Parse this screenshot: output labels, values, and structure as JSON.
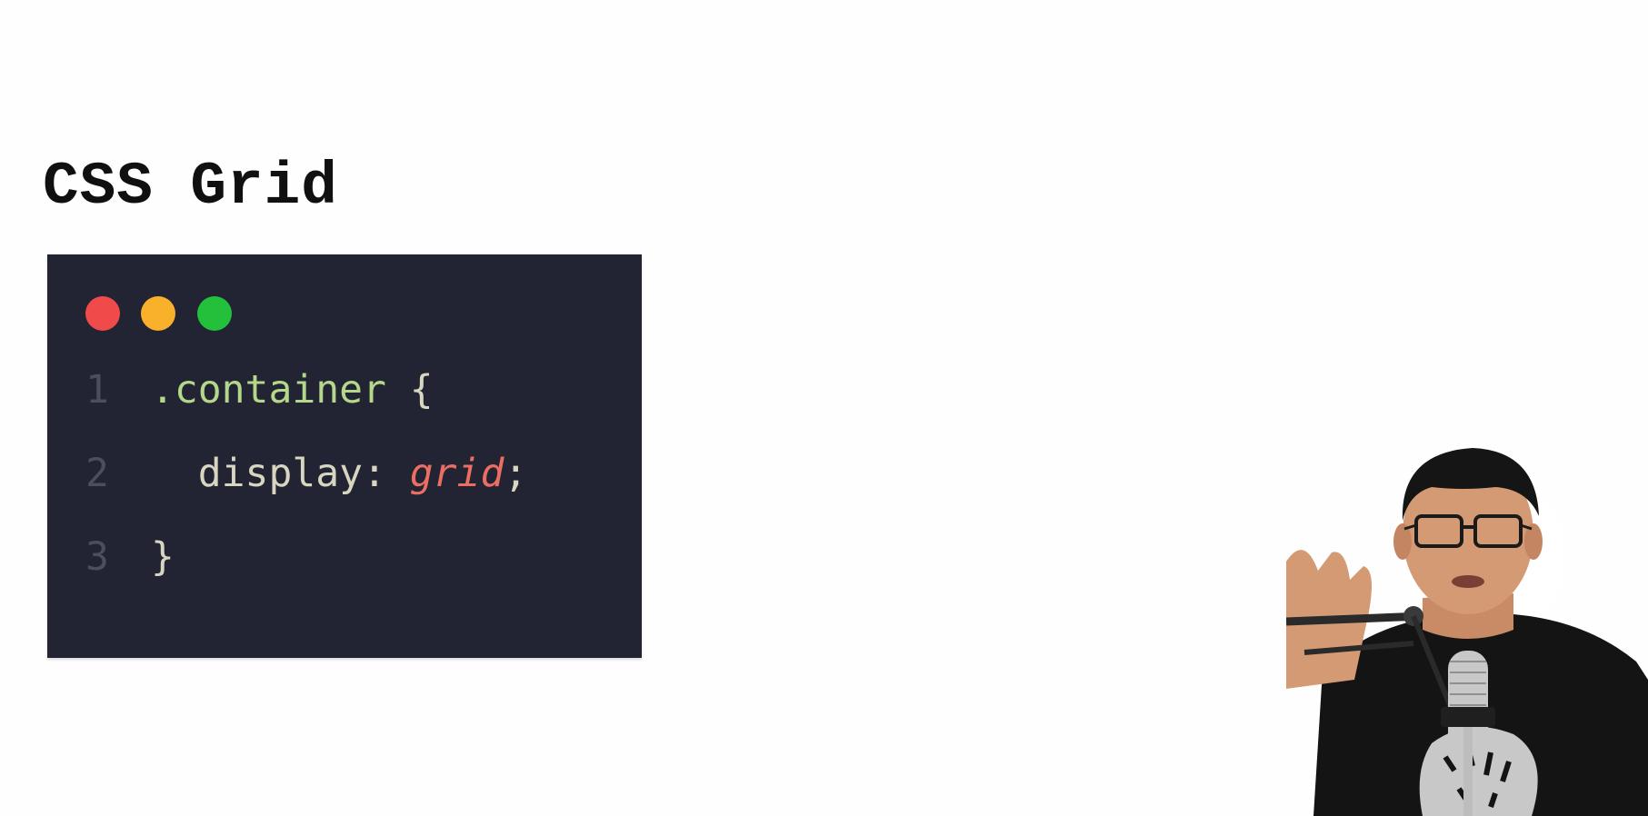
{
  "slide": {
    "title": "CSS Grid"
  },
  "code_window": {
    "traffic_lights": {
      "red": "#f14a4a",
      "yellow": "#f9b12c",
      "green": "#22c03b"
    },
    "lines": [
      {
        "number": "1",
        "selector": ".container",
        "brace": " {"
      },
      {
        "number": "2",
        "property": "  display:",
        "value": "grid",
        "semicolon": ";"
      },
      {
        "number": "3",
        "brace": "}"
      }
    ]
  },
  "colors": {
    "background": "#fefefe",
    "editor_background": "#222433",
    "selector": "#b5d78a",
    "value": "#ec6e62",
    "text": "#d8d6c1"
  }
}
